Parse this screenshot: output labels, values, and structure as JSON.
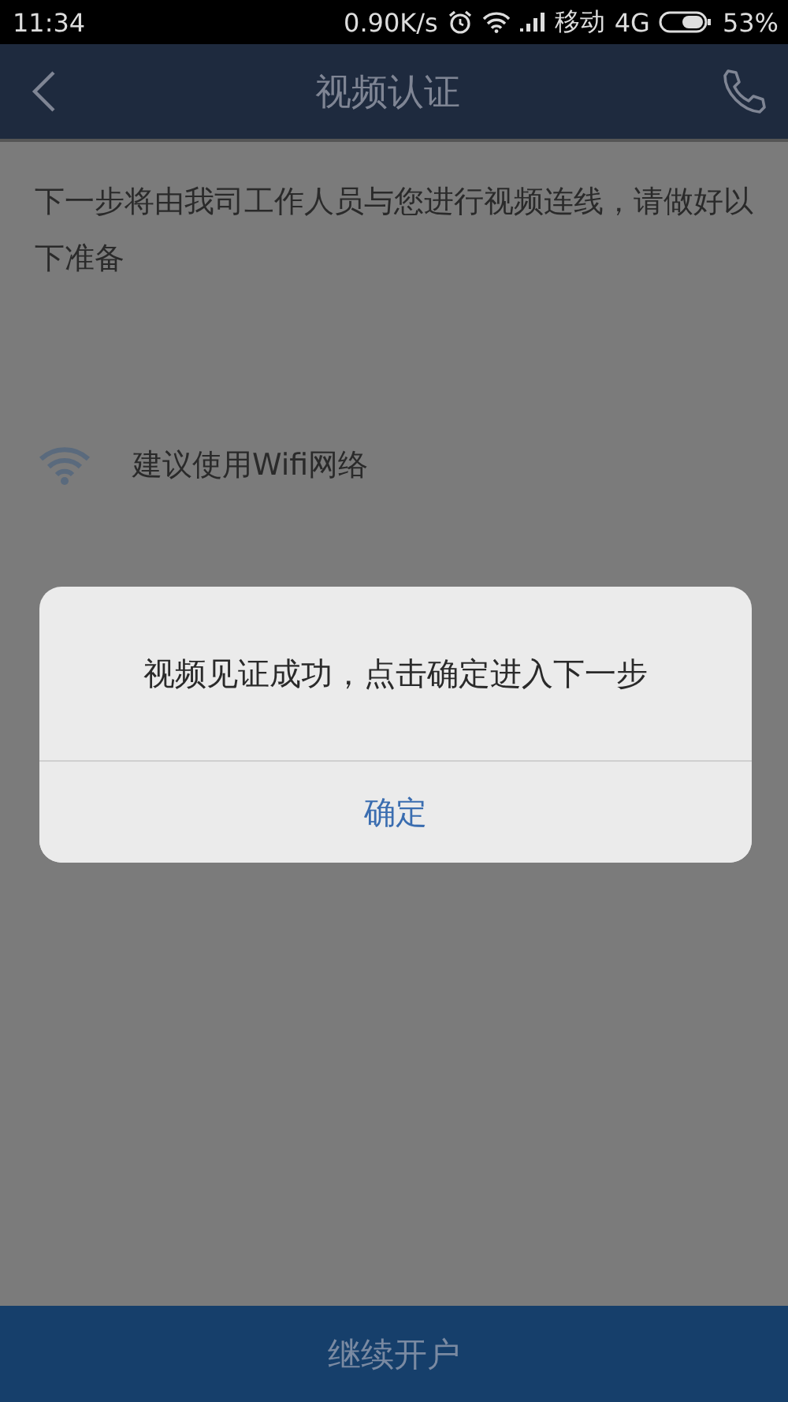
{
  "status_bar": {
    "time": "11:34",
    "net_speed": "0.90K/s",
    "carrier": "移动",
    "network": "4G",
    "battery": "53%"
  },
  "header": {
    "title": "视频认证"
  },
  "intro": "下一步将由我司工作人员与您进行视频连线，请做好以下准备",
  "tips": [
    {
      "kind": "wifi",
      "text": "建议使用Wifi网络"
    }
  ],
  "dialog": {
    "message": "视频见证成功，点击确定进入下一步",
    "button": "确定"
  },
  "bottom_button": "继续开户"
}
